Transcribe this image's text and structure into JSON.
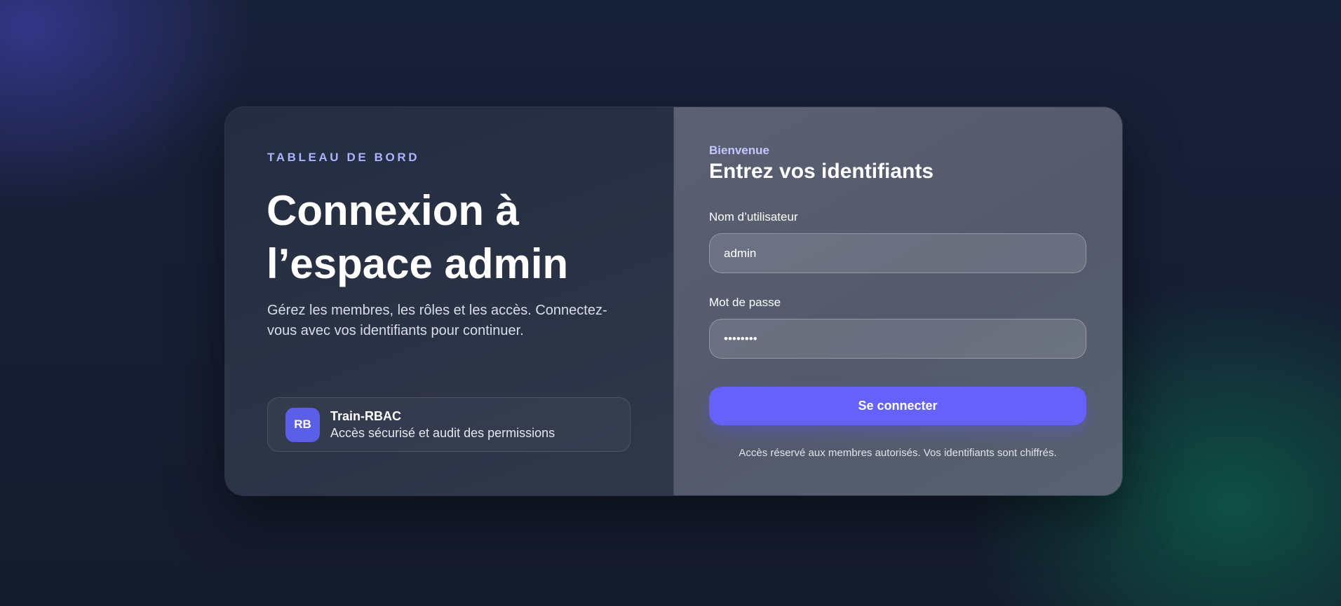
{
  "left_panel": {
    "eyebrow": "TABLEAU DE BORD",
    "headline_line1": "Connexion à",
    "headline_line2": "l’espace admin",
    "description": "Gérez les membres, les rôles et les accès. Connectez-vous avec vos identifiants pour continuer.",
    "brand": {
      "initials": "RB",
      "name": "Train-RBAC",
      "tagline": "Accès sécurisé et audit des permissions"
    }
  },
  "login_form": {
    "welcome": "Bienvenue",
    "title": "Entrez vos identifiants",
    "username": {
      "label": "Nom d’utilisateur",
      "value": "admin"
    },
    "password": {
      "label": "Mot de passe",
      "value": "********"
    },
    "submit_label": "Se connecter",
    "footnote": "Accès réservé aux membres autorisés. Vos identifiants sont chiffrés."
  },
  "colors": {
    "accent": "#6561fa",
    "eyebrow": "#aab4ff",
    "avatar": "#5b5ee6"
  }
}
